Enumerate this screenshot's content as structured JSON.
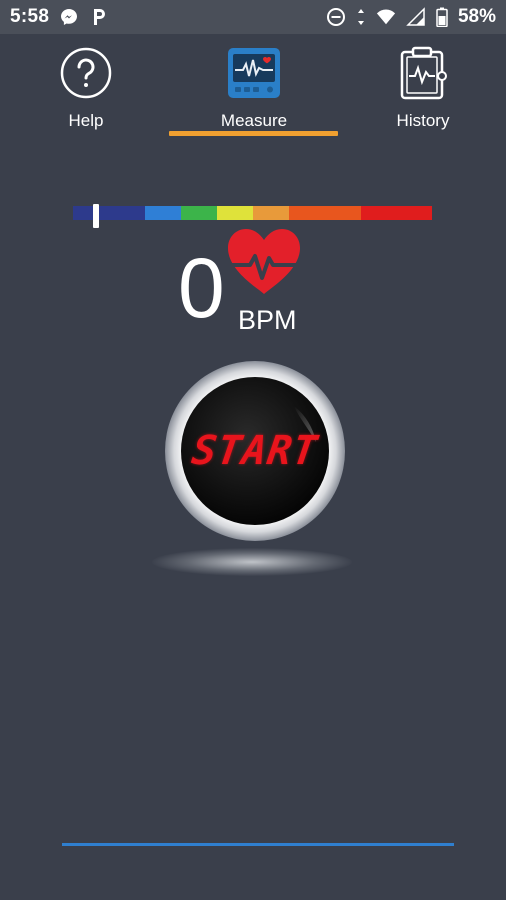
{
  "status_bar": {
    "time": "5:58",
    "battery_percent": "58%",
    "icons": [
      "messenger-icon",
      "p-app-icon",
      "do-not-disturb-icon",
      "data-arrows-icon",
      "wifi-icon",
      "cell-signal-icon",
      "battery-icon"
    ]
  },
  "tabs": {
    "help": {
      "label": "Help",
      "icon": "help-icon"
    },
    "measure": {
      "label": "Measure",
      "icon": "monitor-icon",
      "selected": true
    },
    "history": {
      "label": "History",
      "icon": "clipboard-icon"
    },
    "indicator_color": "#f0a030"
  },
  "scale": {
    "colors": [
      "#2d3a8c",
      "#2f7fd6",
      "#3cb44a",
      "#dfe23a",
      "#e89a3a",
      "#e8561e",
      "#e01d1d"
    ],
    "marker_value": 0
  },
  "reading": {
    "value": "0",
    "unit": "BPM"
  },
  "start_button": {
    "label": "START",
    "text_color": "#e8141c"
  },
  "theme": {
    "background": "#3a3f4b",
    "accent": "#2f7fcf"
  }
}
